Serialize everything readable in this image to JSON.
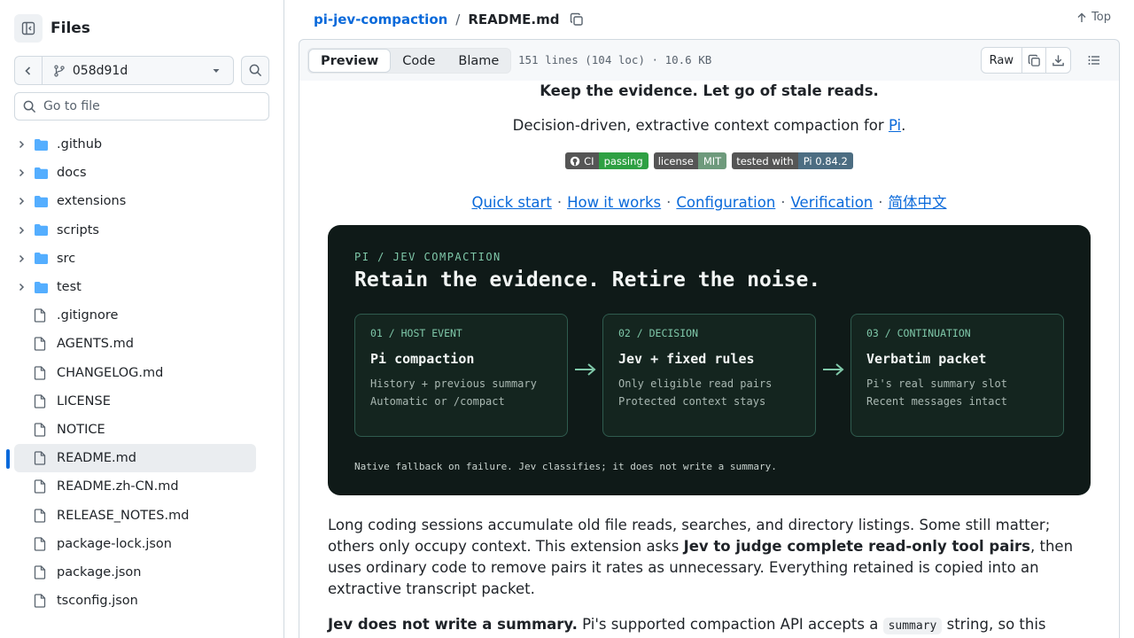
{
  "sidebar": {
    "title": "Files",
    "branch": "058d91d",
    "goto_placeholder": "Go to file",
    "items": [
      {
        "label": ".github",
        "type": "folder"
      },
      {
        "label": "docs",
        "type": "folder"
      },
      {
        "label": "extensions",
        "type": "folder"
      },
      {
        "label": "scripts",
        "type": "folder"
      },
      {
        "label": "src",
        "type": "folder"
      },
      {
        "label": "test",
        "type": "folder"
      },
      {
        "label": ".gitignore",
        "type": "file"
      },
      {
        "label": "AGENTS.md",
        "type": "file"
      },
      {
        "label": "CHANGELOG.md",
        "type": "file"
      },
      {
        "label": "LICENSE",
        "type": "file"
      },
      {
        "label": "NOTICE",
        "type": "file"
      },
      {
        "label": "README.md",
        "type": "file",
        "active": true
      },
      {
        "label": "README.zh-CN.md",
        "type": "file"
      },
      {
        "label": "RELEASE_NOTES.md",
        "type": "file"
      },
      {
        "label": "package-lock.json",
        "type": "file"
      },
      {
        "label": "package.json",
        "type": "file"
      },
      {
        "label": "tsconfig.json",
        "type": "file"
      }
    ]
  },
  "header": {
    "repo": "pi-jev-compaction",
    "separator": "/",
    "file": "README.md",
    "top_label": "Top"
  },
  "toolbar": {
    "tabs": [
      "Preview",
      "Code",
      "Blame"
    ],
    "file_info": "151 lines (104 loc) · 10.6 KB",
    "raw_label": "Raw"
  },
  "readme": {
    "tagline": "Keep the evidence. Let go of stale reads.",
    "subline_pre": "Decision-driven, extractive context compaction for ",
    "subline_link": "Pi",
    "subline_post": ".",
    "badges": [
      {
        "left": "CI",
        "right": "passing",
        "color": "#2ea043"
      },
      {
        "left": "license",
        "right": "MIT",
        "color": "#6e9a7c"
      },
      {
        "left": "tested with",
        "right": "Pi 0.84.2",
        "color": "#4c6d82"
      }
    ],
    "nav": [
      "Quick start",
      "How it works",
      "Configuration",
      "Verification",
      "简体中文"
    ],
    "nav_sep": "·",
    "hero": {
      "kicker": "PI / JEV COMPACTION",
      "title": "Retain the evidence. Retire the noise.",
      "cards": [
        {
          "kicker": "01 / HOST EVENT",
          "title": "Pi compaction",
          "line1": "History + previous summary",
          "line2": "Automatic or /compact"
        },
        {
          "kicker": "02 / DECISION",
          "title": "Jev + fixed rules",
          "line1": "Only eligible read pairs",
          "line2": "Protected context stays"
        },
        {
          "kicker": "03 / CONTINUATION",
          "title": "Verbatim packet",
          "line1": "Pi's real summary slot",
          "line2": "Recent messages intact"
        }
      ],
      "footer": "Native fallback on failure. Jev classifies; it does not write a summary.",
      "accent": "#7fc8a9"
    },
    "para1_a": "Long coding sessions accumulate old file reads, searches, and directory listings. Some still matter; others only occupy context. This extension asks ",
    "para1_bold": "Jev to judge complete read-only tool pairs",
    "para1_b": ", then uses ordinary code to remove pairs it rates as unnecessary. Everything retained is copied into an extractive transcript packet.",
    "para2_bold": "Jev does not write a summary.",
    "para2_a": " Pi's supported compaction API accepts a ",
    "para2_code": "summary",
    "para2_b": " string, so this"
  },
  "colors": {
    "link": "#0969da",
    "active_bar": "#0969da",
    "folder": "#54aeff"
  }
}
